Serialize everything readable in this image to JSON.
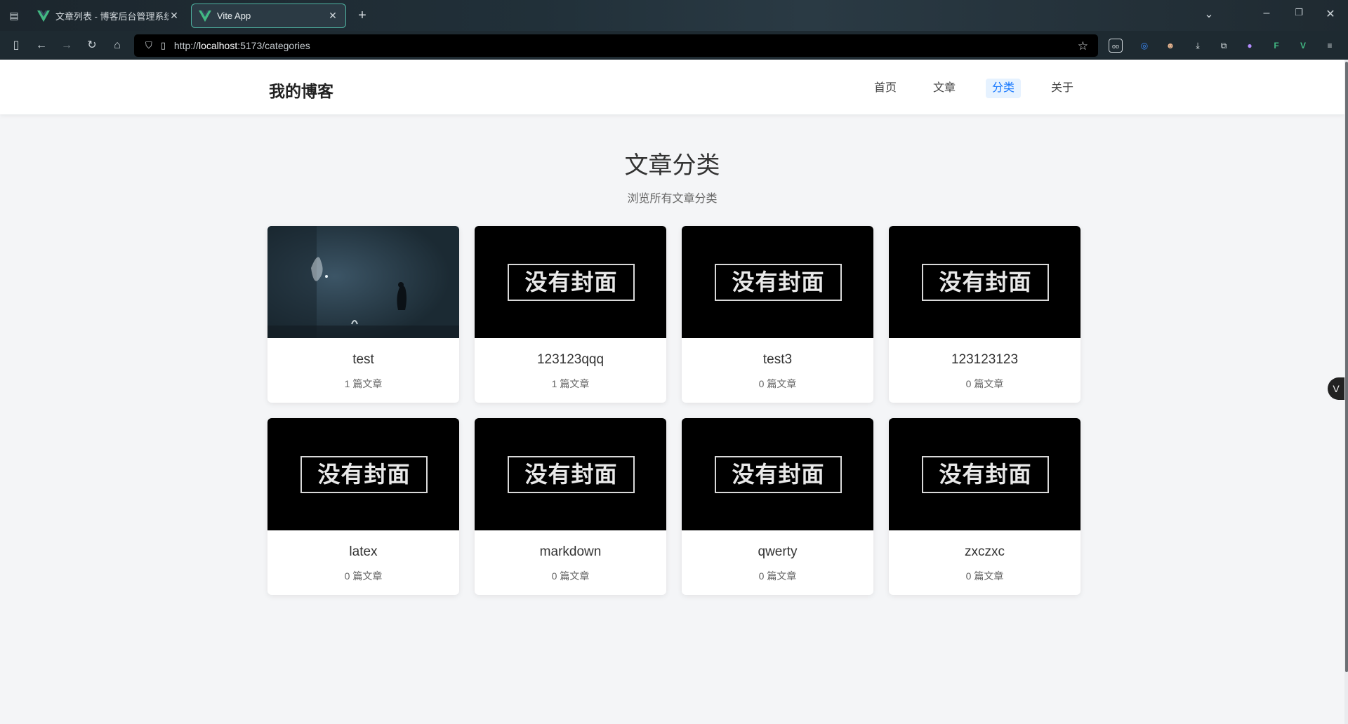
{
  "browser": {
    "tabs": [
      {
        "label": "文章列表 - 博客后台管理系统",
        "active": false
      },
      {
        "label": "Vite App",
        "active": true
      }
    ],
    "url_scheme": "http://",
    "url_host": "localhost",
    "url_rest": ":5173/categories"
  },
  "site": {
    "brand": "我的博客",
    "nav": [
      {
        "label": "首页",
        "active": false
      },
      {
        "label": "文章",
        "active": false
      },
      {
        "label": "分类",
        "active": true
      },
      {
        "label": "关于",
        "active": false
      }
    ]
  },
  "main": {
    "title": "文章分类",
    "subtitle": "浏览所有文章分类",
    "no_cover_text": "没有封面",
    "categories": [
      {
        "name": "test",
        "count": "1 篇文章",
        "has_cover": true
      },
      {
        "name": "123123qqq",
        "count": "1 篇文章",
        "has_cover": false
      },
      {
        "name": "test3",
        "count": "0 篇文章",
        "has_cover": false
      },
      {
        "name": "123123123",
        "count": "0 篇文章",
        "has_cover": false
      },
      {
        "name": "latex",
        "count": "0 篇文章",
        "has_cover": false
      },
      {
        "name": "markdown",
        "count": "0 篇文章",
        "has_cover": false
      },
      {
        "name": "qwerty",
        "count": "0 篇文章",
        "has_cover": false
      },
      {
        "name": "zxczxc",
        "count": "0 篇文章",
        "has_cover": false
      }
    ]
  },
  "colors": {
    "accent": "#1677ff",
    "active_bg": "#e6f2ff",
    "vue_green": "#42b883"
  }
}
